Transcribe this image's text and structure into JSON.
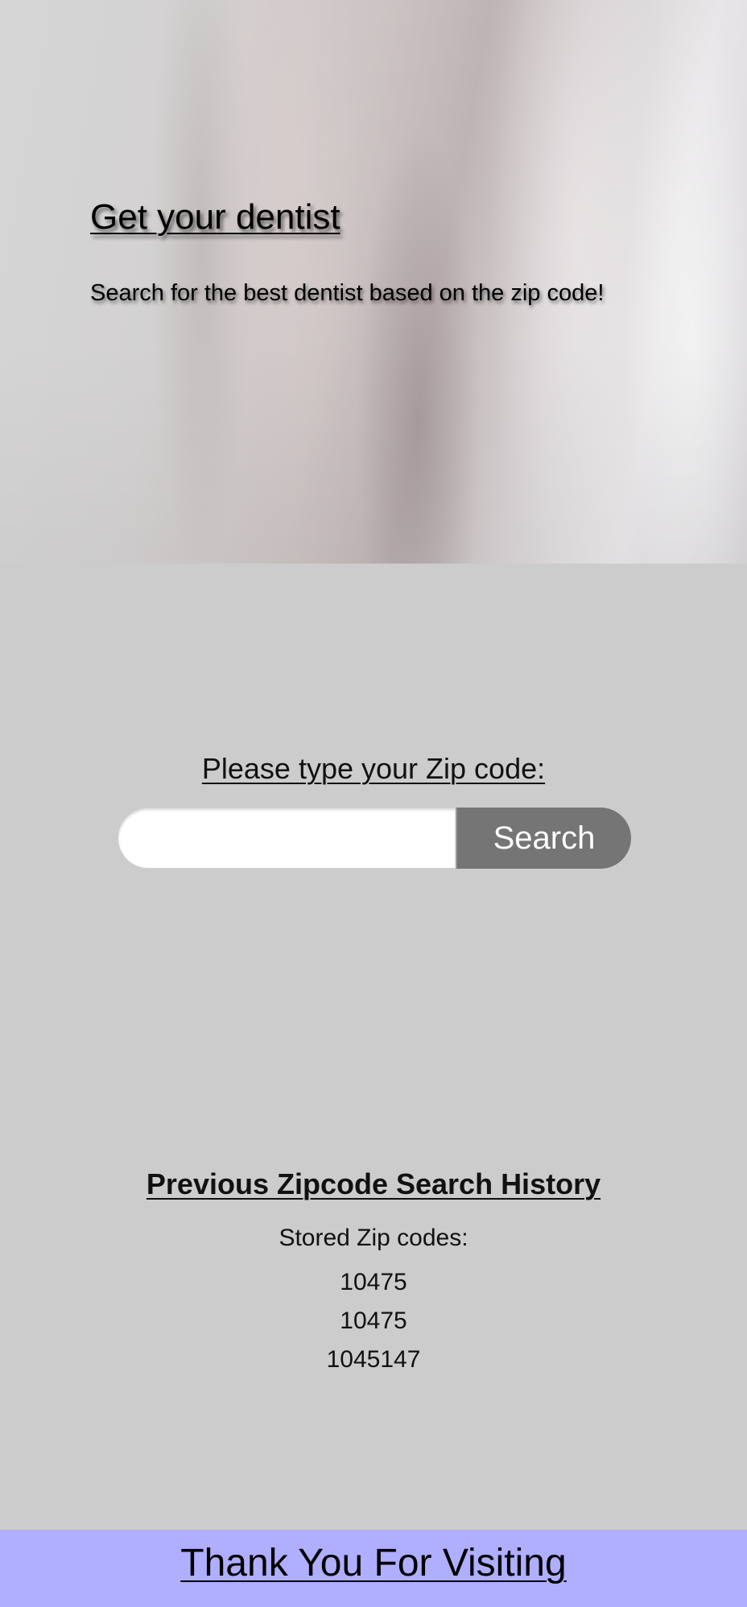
{
  "hero": {
    "title": "Get your dentist",
    "subtitle": "Search for the best dentist based on the zip code!"
  },
  "search": {
    "label": "Please type your Zip code:",
    "input_value": "",
    "placeholder": "",
    "button_label": "Search"
  },
  "history": {
    "title": "Previous Zipcode Search History",
    "stored_label": "Stored Zip codes:",
    "zip_codes": [
      "10475",
      "10475",
      "1045147"
    ]
  },
  "footer": {
    "text": "Thank You For Visiting"
  },
  "colors": {
    "page_background": "#cccccc",
    "button_background": "#757575",
    "footer_background": "#b0aeff"
  }
}
